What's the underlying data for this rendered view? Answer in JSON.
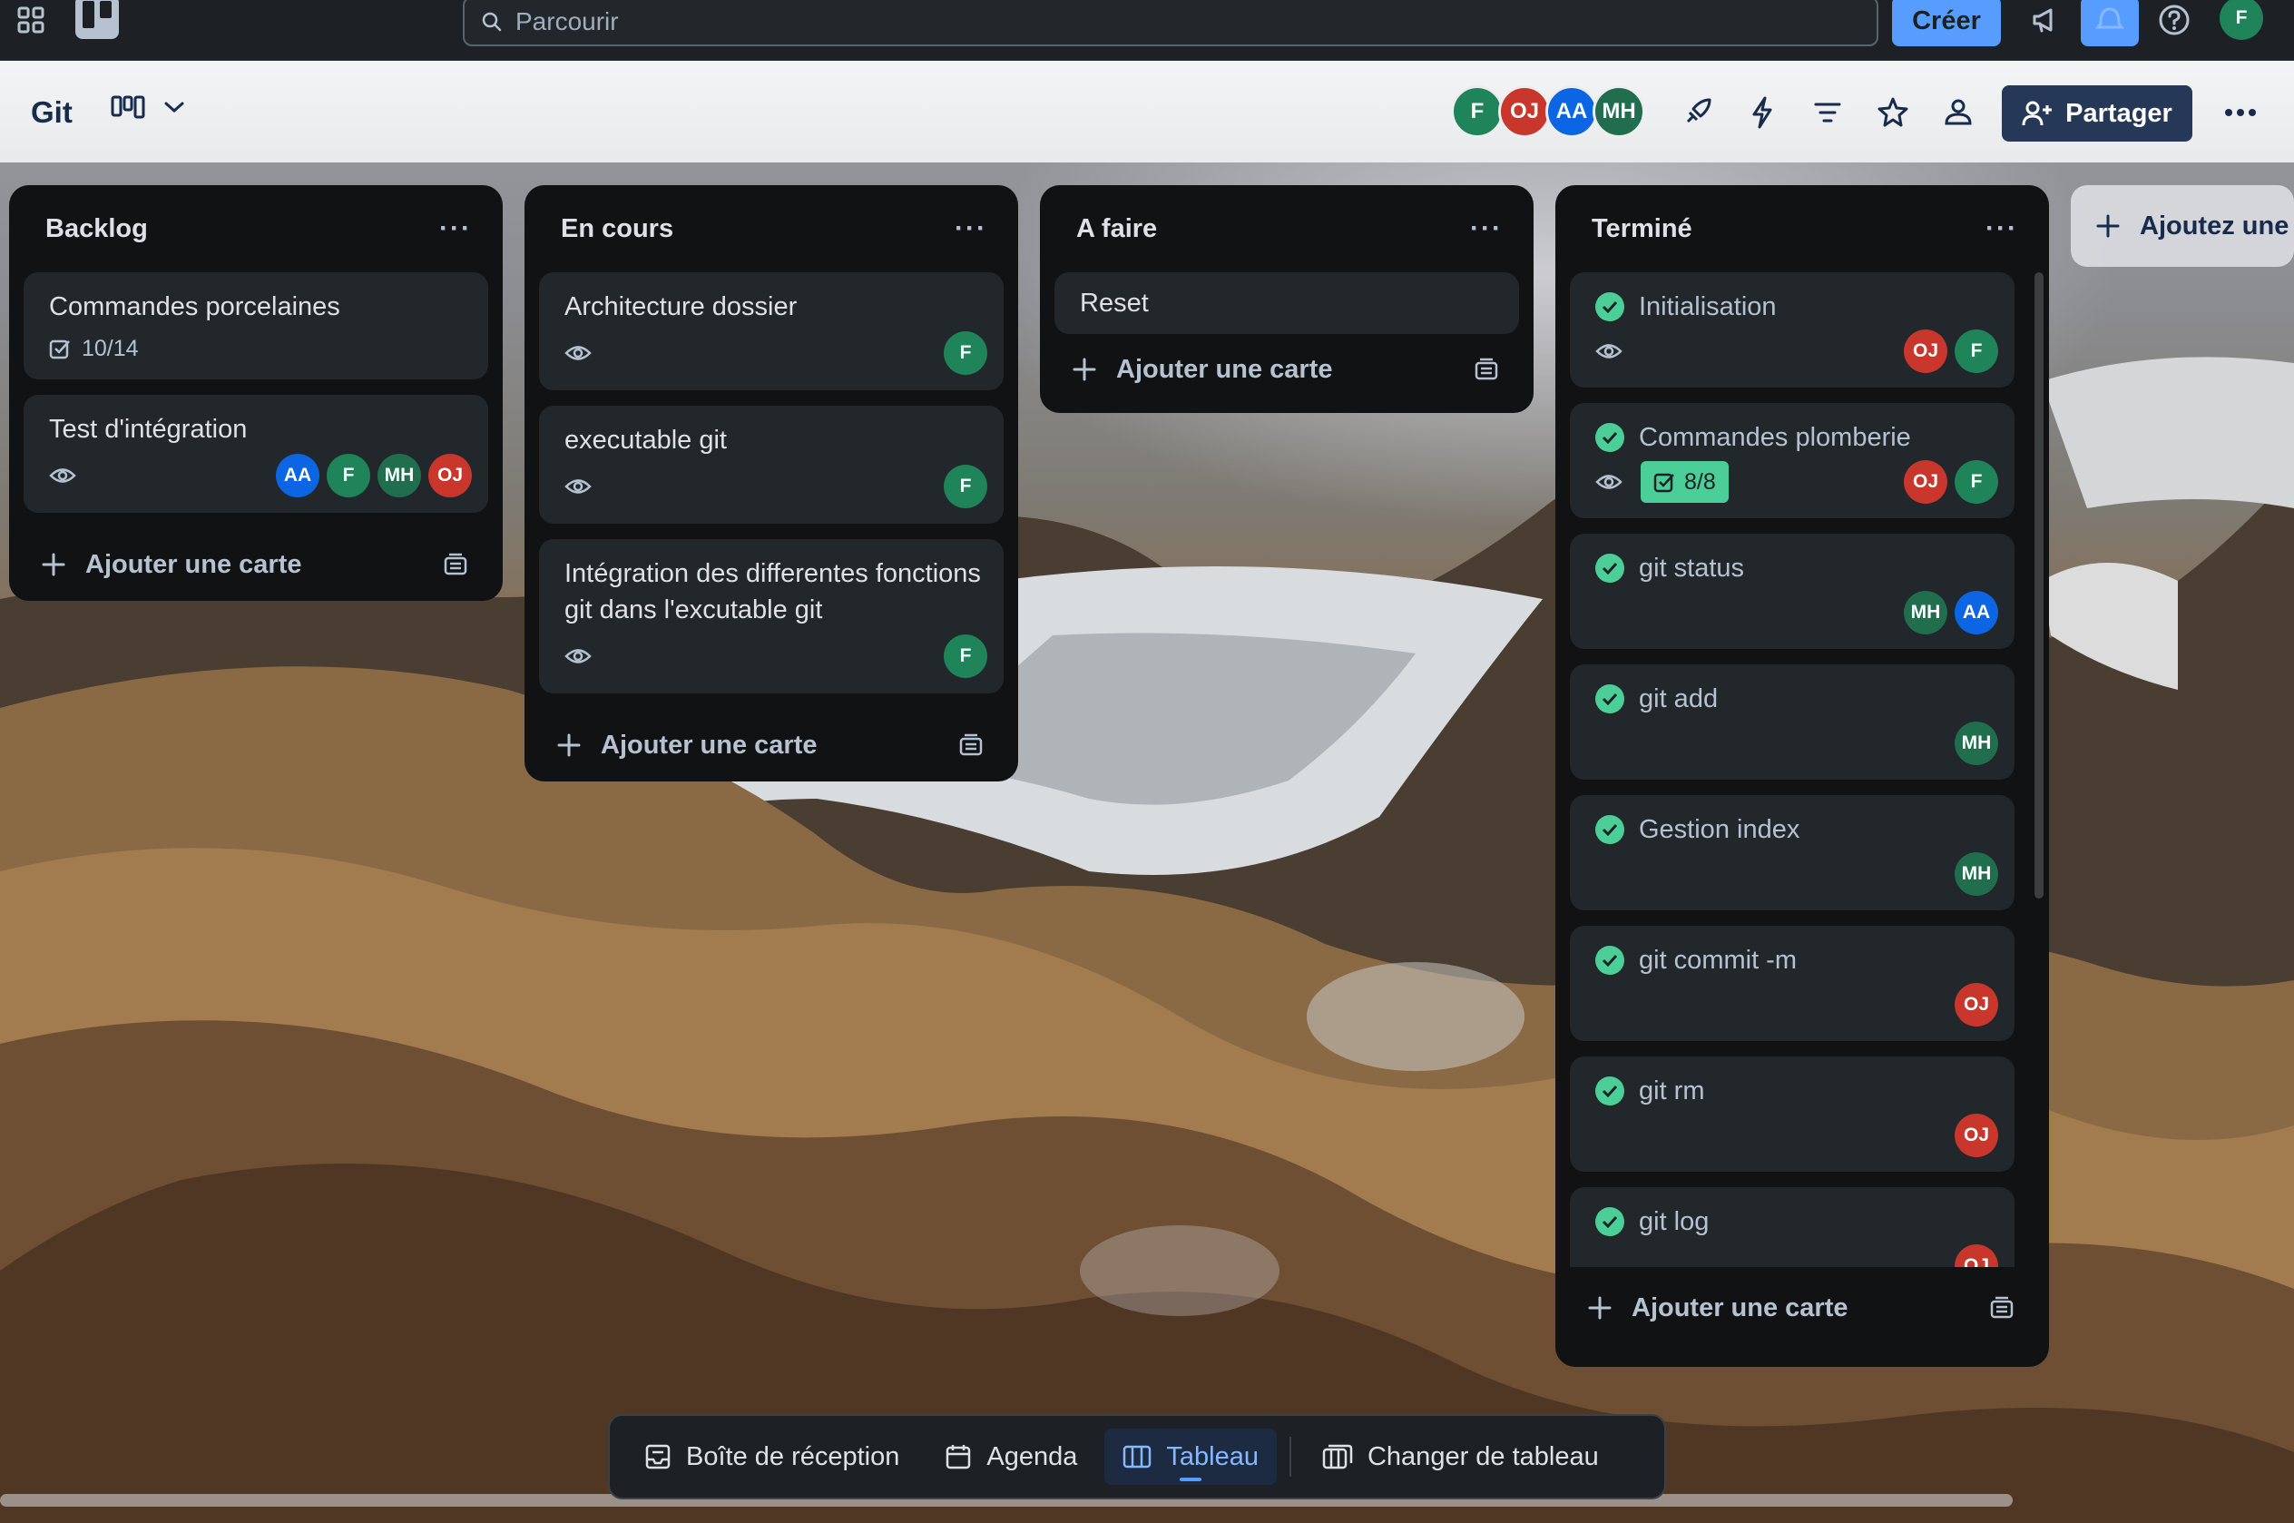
{
  "topbar": {
    "search_placeholder": "Parcourir",
    "create_label": "Créer",
    "user_initial": "F"
  },
  "board": {
    "title": "Git",
    "members": [
      "F",
      "OJ",
      "AA",
      "MH"
    ],
    "share_label": "Partager"
  },
  "colors": {
    "F": "#1f845a",
    "OJ": "#c9372c",
    "AA": "#0c66e4",
    "MH": "#216e4e",
    "accent": "#579dff",
    "done": "#4bce97"
  },
  "lists": [
    {
      "title": "Backlog",
      "cards": [
        {
          "title": "Commandes porcelaines",
          "checklist": "10/14",
          "members": []
        },
        {
          "title": "Test d'intégration",
          "watch": true,
          "members": [
            "AA",
            "F",
            "MH",
            "OJ"
          ]
        }
      ],
      "add_label": "Ajouter une carte"
    },
    {
      "title": "En cours",
      "cards": [
        {
          "title": "Architecture dossier",
          "watch": true,
          "members": [
            "F"
          ]
        },
        {
          "title": "executable git",
          "watch": true,
          "members": [
            "F"
          ]
        },
        {
          "title": "Intégration des differentes fonctions git dans l'excutable git",
          "watch": true,
          "members": [
            "F"
          ]
        }
      ],
      "add_label": "Ajouter une carte"
    },
    {
      "title": "A faire",
      "cards": [
        {
          "title": "Reset",
          "members": []
        }
      ],
      "add_label": "Ajouter une carte"
    },
    {
      "title": "Terminé",
      "cards": [
        {
          "title": "Initialisation",
          "watch": true,
          "members": [
            "OJ",
            "F"
          ]
        },
        {
          "title": "Commandes plomberie",
          "watch": true,
          "checklist": "8/8",
          "members": [
            "OJ",
            "F"
          ]
        },
        {
          "title": "git status",
          "members": [
            "MH",
            "AA"
          ]
        },
        {
          "title": "git add",
          "members": [
            "MH"
          ]
        },
        {
          "title": "Gestion index",
          "members": [
            "MH"
          ]
        },
        {
          "title": "git commit -m",
          "members": [
            "OJ"
          ]
        },
        {
          "title": "git rm",
          "members": [
            "OJ"
          ]
        },
        {
          "title": "git log",
          "members": [
            "OJ"
          ]
        }
      ],
      "add_label": "Ajouter une carte"
    }
  ],
  "add_list_label": "Ajoutez une",
  "bottom_nav": {
    "inbox": "Boîte de réception",
    "agenda": "Agenda",
    "board": "Tableau",
    "switch": "Changer de tableau"
  }
}
